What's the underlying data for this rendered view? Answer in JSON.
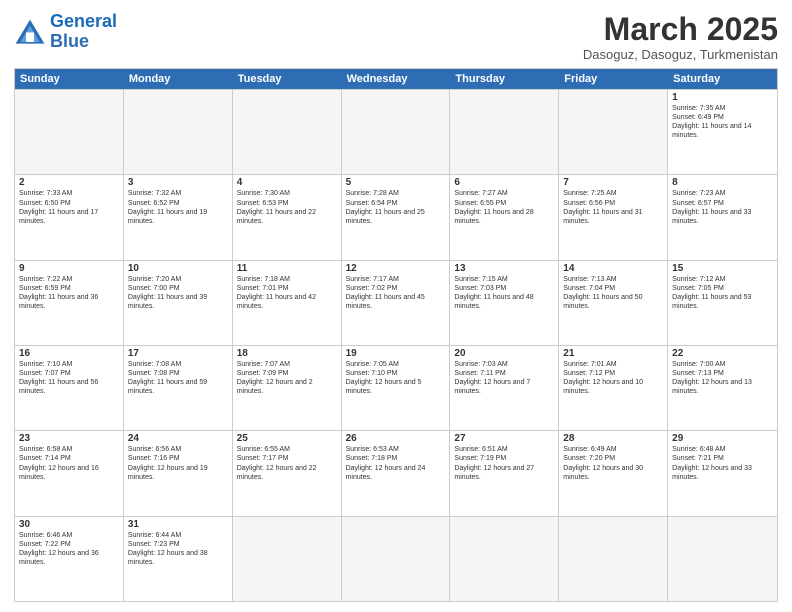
{
  "header": {
    "logo_general": "General",
    "logo_blue": "Blue",
    "month_year": "March 2025",
    "location": "Dasoguz, Dasoguz, Turkmenistan"
  },
  "day_headers": [
    "Sunday",
    "Monday",
    "Tuesday",
    "Wednesday",
    "Thursday",
    "Friday",
    "Saturday"
  ],
  "weeks": [
    [
      {
        "day": "",
        "info": "",
        "empty": true
      },
      {
        "day": "",
        "info": "",
        "empty": true
      },
      {
        "day": "",
        "info": "",
        "empty": true
      },
      {
        "day": "",
        "info": "",
        "empty": true
      },
      {
        "day": "",
        "info": "",
        "empty": true
      },
      {
        "day": "",
        "info": "",
        "empty": true
      },
      {
        "day": "1",
        "info": "Sunrise: 7:35 AM\nSunset: 6:49 PM\nDaylight: 11 hours and 14 minutes.",
        "empty": false
      }
    ],
    [
      {
        "day": "2",
        "info": "Sunrise: 7:33 AM\nSunset: 6:50 PM\nDaylight: 11 hours and 17 minutes.",
        "empty": false
      },
      {
        "day": "3",
        "info": "Sunrise: 7:32 AM\nSunset: 6:52 PM\nDaylight: 11 hours and 19 minutes.",
        "empty": false
      },
      {
        "day": "4",
        "info": "Sunrise: 7:30 AM\nSunset: 6:53 PM\nDaylight: 11 hours and 22 minutes.",
        "empty": false
      },
      {
        "day": "5",
        "info": "Sunrise: 7:28 AM\nSunset: 6:54 PM\nDaylight: 11 hours and 25 minutes.",
        "empty": false
      },
      {
        "day": "6",
        "info": "Sunrise: 7:27 AM\nSunset: 6:55 PM\nDaylight: 11 hours and 28 minutes.",
        "empty": false
      },
      {
        "day": "7",
        "info": "Sunrise: 7:25 AM\nSunset: 6:56 PM\nDaylight: 11 hours and 31 minutes.",
        "empty": false
      },
      {
        "day": "8",
        "info": "Sunrise: 7:23 AM\nSunset: 6:57 PM\nDaylight: 11 hours and 33 minutes.",
        "empty": false
      }
    ],
    [
      {
        "day": "9",
        "info": "Sunrise: 7:22 AM\nSunset: 6:59 PM\nDaylight: 11 hours and 36 minutes.",
        "empty": false
      },
      {
        "day": "10",
        "info": "Sunrise: 7:20 AM\nSunset: 7:00 PM\nDaylight: 11 hours and 39 minutes.",
        "empty": false
      },
      {
        "day": "11",
        "info": "Sunrise: 7:18 AM\nSunset: 7:01 PM\nDaylight: 11 hours and 42 minutes.",
        "empty": false
      },
      {
        "day": "12",
        "info": "Sunrise: 7:17 AM\nSunset: 7:02 PM\nDaylight: 11 hours and 45 minutes.",
        "empty": false
      },
      {
        "day": "13",
        "info": "Sunrise: 7:15 AM\nSunset: 7:03 PM\nDaylight: 11 hours and 48 minutes.",
        "empty": false
      },
      {
        "day": "14",
        "info": "Sunrise: 7:13 AM\nSunset: 7:04 PM\nDaylight: 11 hours and 50 minutes.",
        "empty": false
      },
      {
        "day": "15",
        "info": "Sunrise: 7:12 AM\nSunset: 7:05 PM\nDaylight: 11 hours and 53 minutes.",
        "empty": false
      }
    ],
    [
      {
        "day": "16",
        "info": "Sunrise: 7:10 AM\nSunset: 7:07 PM\nDaylight: 11 hours and 56 minutes.",
        "empty": false
      },
      {
        "day": "17",
        "info": "Sunrise: 7:08 AM\nSunset: 7:08 PM\nDaylight: 11 hours and 59 minutes.",
        "empty": false
      },
      {
        "day": "18",
        "info": "Sunrise: 7:07 AM\nSunset: 7:09 PM\nDaylight: 12 hours and 2 minutes.",
        "empty": false
      },
      {
        "day": "19",
        "info": "Sunrise: 7:05 AM\nSunset: 7:10 PM\nDaylight: 12 hours and 5 minutes.",
        "empty": false
      },
      {
        "day": "20",
        "info": "Sunrise: 7:03 AM\nSunset: 7:11 PM\nDaylight: 12 hours and 7 minutes.",
        "empty": false
      },
      {
        "day": "21",
        "info": "Sunrise: 7:01 AM\nSunset: 7:12 PM\nDaylight: 12 hours and 10 minutes.",
        "empty": false
      },
      {
        "day": "22",
        "info": "Sunrise: 7:00 AM\nSunset: 7:13 PM\nDaylight: 12 hours and 13 minutes.",
        "empty": false
      }
    ],
    [
      {
        "day": "23",
        "info": "Sunrise: 6:58 AM\nSunset: 7:14 PM\nDaylight: 12 hours and 16 minutes.",
        "empty": false
      },
      {
        "day": "24",
        "info": "Sunrise: 6:56 AM\nSunset: 7:16 PM\nDaylight: 12 hours and 19 minutes.",
        "empty": false
      },
      {
        "day": "25",
        "info": "Sunrise: 6:55 AM\nSunset: 7:17 PM\nDaylight: 12 hours and 22 minutes.",
        "empty": false
      },
      {
        "day": "26",
        "info": "Sunrise: 6:53 AM\nSunset: 7:18 PM\nDaylight: 12 hours and 24 minutes.",
        "empty": false
      },
      {
        "day": "27",
        "info": "Sunrise: 6:51 AM\nSunset: 7:19 PM\nDaylight: 12 hours and 27 minutes.",
        "empty": false
      },
      {
        "day": "28",
        "info": "Sunrise: 6:49 AM\nSunset: 7:20 PM\nDaylight: 12 hours and 30 minutes.",
        "empty": false
      },
      {
        "day": "29",
        "info": "Sunrise: 6:48 AM\nSunset: 7:21 PM\nDaylight: 12 hours and 33 minutes.",
        "empty": false
      }
    ],
    [
      {
        "day": "30",
        "info": "Sunrise: 6:46 AM\nSunset: 7:22 PM\nDaylight: 12 hours and 36 minutes.",
        "empty": false
      },
      {
        "day": "31",
        "info": "Sunrise: 6:44 AM\nSunset: 7:23 PM\nDaylight: 12 hours and 38 minutes.",
        "empty": false
      },
      {
        "day": "",
        "info": "",
        "empty": true
      },
      {
        "day": "",
        "info": "",
        "empty": true
      },
      {
        "day": "",
        "info": "",
        "empty": true
      },
      {
        "day": "",
        "info": "",
        "empty": true
      },
      {
        "day": "",
        "info": "",
        "empty": true
      }
    ]
  ]
}
